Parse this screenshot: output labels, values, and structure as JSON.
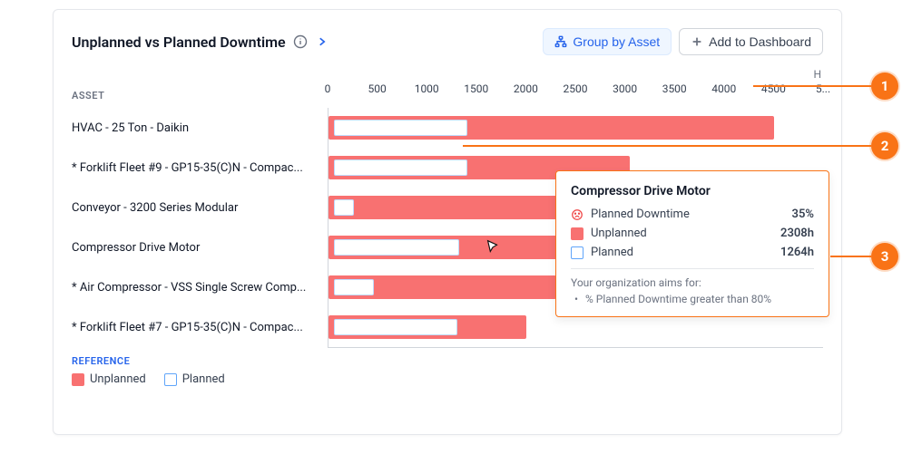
{
  "header": {
    "title": "Unplanned vs Planned Downtime",
    "group_button": "Group by Asset",
    "add_button": "Add to Dashboard"
  },
  "axis": {
    "unit": "H",
    "label": "ASSET",
    "max": 5000,
    "ticks": [
      "0",
      "500",
      "1000",
      "1500",
      "2000",
      "2500",
      "3000",
      "3500",
      "4000",
      "4500",
      "5..."
    ]
  },
  "legend": {
    "title": "REFERENCE",
    "unplanned": "Unplanned",
    "planned": "Planned"
  },
  "tooltip": {
    "title": "Compressor Drive Motor",
    "pct_label": "Planned Downtime",
    "pct_value": "35%",
    "unplanned_label": "Unplanned",
    "unplanned_value": "2308h",
    "planned_label": "Planned",
    "planned_value": "1264h",
    "org_label": "Your organization aims for:",
    "org_goal": "% Planned Downtime greater than 80%"
  },
  "callouts": {
    "c1": "1",
    "c2": "2",
    "c3": "3"
  },
  "chart_data": {
    "type": "bar",
    "xlabel": "",
    "ylabel": "H",
    "xlim": [
      0,
      5000
    ],
    "assets": [
      {
        "name": "HVAC - 25 Ton - Daikin",
        "unplanned": 4500,
        "planned": 1350
      },
      {
        "name": "* Forklift Fleet #9 - GP15-35(C)N - Compac...",
        "unplanned": 3050,
        "planned": 1350
      },
      {
        "name": "Conveyor - 3200 Series Modular",
        "unplanned": 2350,
        "planned": 200
      },
      {
        "name": "Compressor Drive Motor",
        "unplanned": 2308,
        "planned": 1264
      },
      {
        "name": "* Air Compressor - VSS Single Screw Comp...",
        "unplanned": 2300,
        "planned": 400
      },
      {
        "name": "* Forklift Fleet #7 - GP15-35(C)N - Compac...",
        "unplanned": 2000,
        "planned": 1250
      }
    ]
  }
}
